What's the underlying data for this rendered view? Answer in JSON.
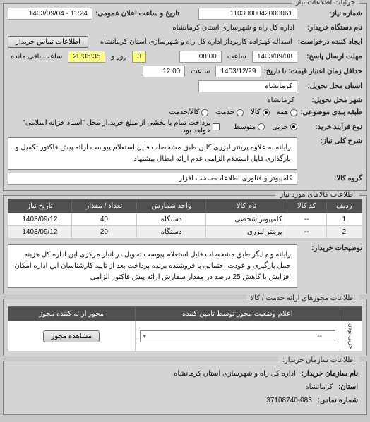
{
  "panel1": {
    "title": "جزئیات اطلاعات نیاز",
    "need_number_label": "شماره نیاز:",
    "need_number": "1103000042000061",
    "announce_label": "تاریخ و ساعت اعلان عمومی:",
    "announce_value": "11:24 - 1403/09/04",
    "requester_label": "نام دستگاه خریدار:",
    "requester_value": "اداره کل راه و شهرسازی استان کرمانشاه",
    "creator_label": "ایجاد کننده درخواست:",
    "creator_value": "اسداله کهنزاده کارپرداز اداره کل راه و شهرسازی استان کرمانشاه",
    "contact_btn": "اطلاعات تماس خریدار",
    "deadline_send_label": "مهلت ارسال پاسخ:",
    "date1": "1403/09/08",
    "hour_label": "ساعت",
    "hour1": "08:00",
    "remain_num": "3",
    "remain_day": "روز و",
    "remain_time": "20:35:35",
    "remain_suffix": "ساعت باقی مانده",
    "price_credit_label": "حداقل زمان اعتبار قیمت: تا تاریخ:",
    "date2": "1403/12/29",
    "hour2": "12:00",
    "province_label": "استان محل تحویل:",
    "province": "کرمانشاه",
    "city_label": "شهر محل تحویل:",
    "city": "کرمانشاه",
    "subject_type_label": "طبقه بندی موضوعی:",
    "radio_all": "همه",
    "radio_goods": "کالا",
    "radio_service": "خدمت",
    "radio_goods_service": "کالا/خدمت",
    "process_label": "نوع فرآیند خرید:",
    "radio_partial": "جزیی",
    "radio_medium": "متوسط",
    "check_note": "پرداخت تمام یا بخشی از مبلغ خرید،از محل \"اسناد خزانه اسلامی\" خواهد بود.",
    "general_desc_label": "شرح کلی نیاز:",
    "general_desc": "رایانه به علاوه پرینتر لیزری کانن طبق مشخصات فایل استعلام پیوست ارائه پیش فاکتور تکمیل و بارگذاری فایل استعلام الزامی عدم ارائه ابطال پیشنهاد",
    "goods_group_label": "گروه کالا:",
    "goods_group": "کامپیوتر و فناوری اطلاعات-سخت افزار"
  },
  "panel2": {
    "title": "اطلاعات کالاهای مورد نیاز",
    "headers": [
      "ردیف",
      "کد کالا",
      "نام کالا",
      "واحد شمارش",
      "تعداد / مقدار",
      "تاریخ نیاز"
    ],
    "rows": [
      {
        "row": "1",
        "code": "--",
        "name": "کامپیوتر شخصی",
        "unit": "دستگاه",
        "qty": "40",
        "date": "1403/09/12"
      },
      {
        "row": "2",
        "code": "--",
        "name": "پرینتر لیزری",
        "unit": "دستگاه",
        "qty": "20",
        "date": "1403/09/12"
      }
    ],
    "buyer_desc_label": "توضیحات خریدار:",
    "buyer_desc": "رایانه و چاپگر طبق مشخصات فایل استعلام پیوست تحویل در انبار مرکزی این اداره کل هزینه حمل بارگیری و عودت احتمالی با فروشنده برنده پرداخت بعد از تایید کارشناسان این اداره امکان افزایش یا کاهش 25 درصد در مقدار سفارش ارائه پیش فاکتور الزامی"
  },
  "panel3": {
    "title": "اطلاعات مجوزهای ارائه خدمت / کالا",
    "status_header": "اعلام وضعیت مجوز توسط تامین کننده",
    "auth_header": "محور ارائه کننده مجوز",
    "placeholder": "--",
    "view_btn": "مشاهده مجوز",
    "hint": "جزیی بودن"
  },
  "panel4": {
    "title": "اطلاعات سازمان خریدار:",
    "org_label": "نام سازمان خریدار:",
    "org_value": "اداره کل راه و شهرسازی استان کرمانشاه",
    "prov_label": "استان:",
    "prov_value": "کرمانشاه",
    "phone_label": "شماره تماس:",
    "phone_value": "37108740-083"
  }
}
